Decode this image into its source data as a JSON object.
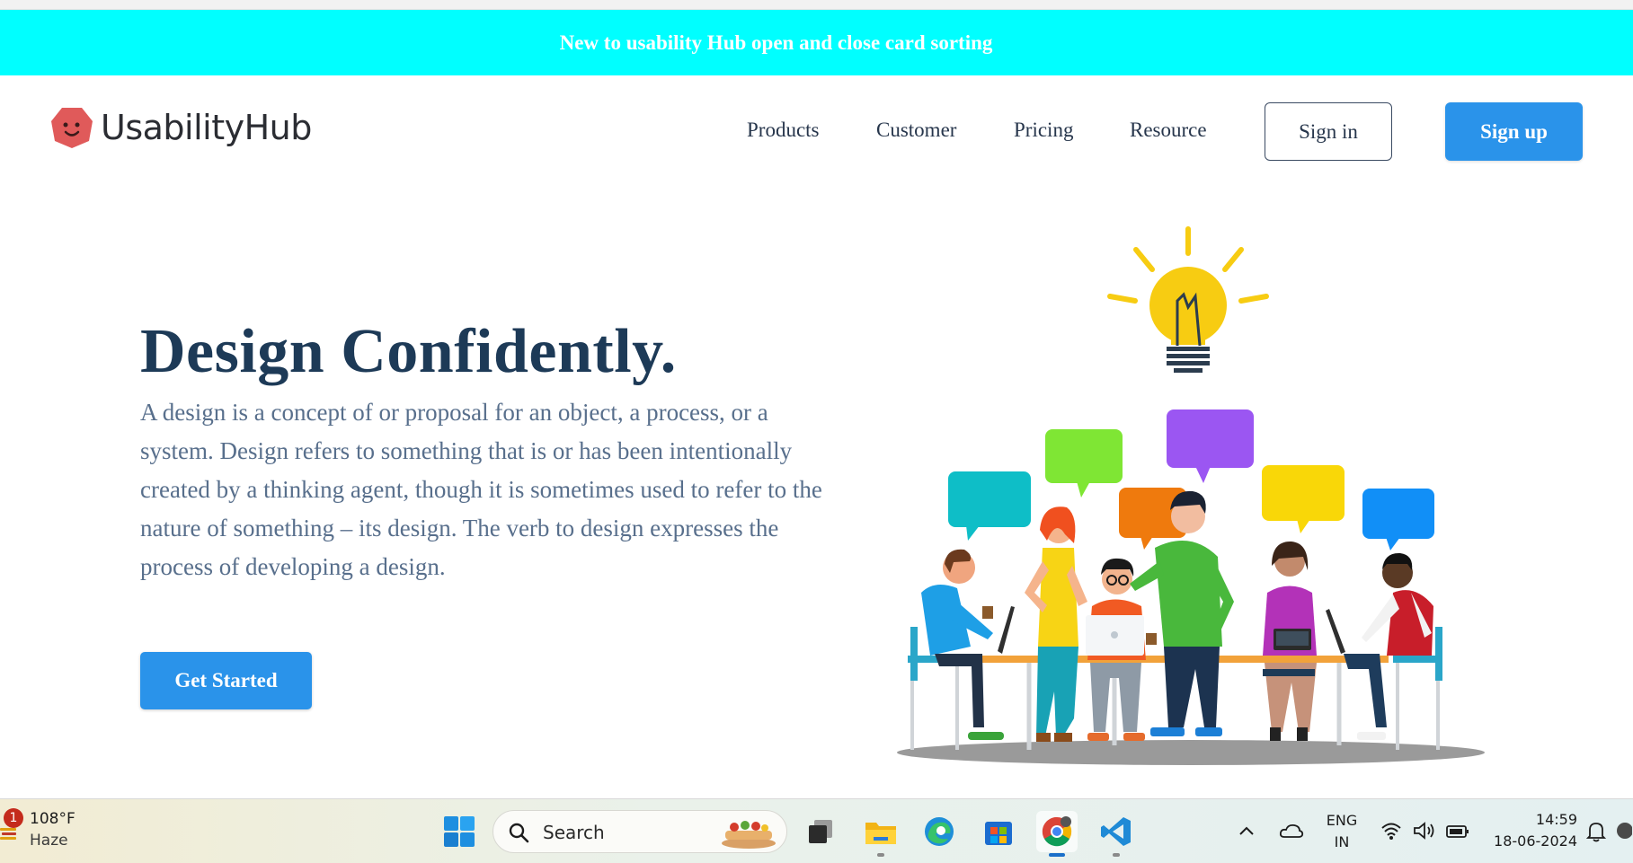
{
  "banner": {
    "text": "New to usability Hub open and close card sorting"
  },
  "brand": {
    "name": "UsabilityHub",
    "logo_color": "#e05a5a"
  },
  "nav": {
    "items": [
      "Products",
      "Customer",
      "Pricing",
      "Resource"
    ],
    "sign_in": "Sign in",
    "sign_up": "Sign up"
  },
  "hero": {
    "title": "Design Confidently.",
    "description": "A design is a concept of or proposal for an object, a process, or a system. Design refers to something that is or has been intentionally created by a thinking agent, though it is sometimes used to refer to the nature of something – its design. The verb to design expresses the process of developing a design.",
    "cta": "Get Started"
  },
  "colors": {
    "banner_bg": "#00ffff",
    "primary": "#2a93ea",
    "heading": "#1d3a57",
    "body_text": "#586f8c"
  },
  "taskbar": {
    "weather": {
      "temp": "108°F",
      "condition": "Haze",
      "badge": "1"
    },
    "search_placeholder": "Search",
    "apps": [
      "start-icon",
      "search",
      "task-view-icon",
      "file-explorer-icon",
      "edge-icon",
      "store-icon",
      "chrome-icon",
      "vscode-icon"
    ],
    "tray": {
      "lang_top": "ENG",
      "lang_bottom": "IN",
      "time": "14:59",
      "date": "18-06-2024"
    }
  }
}
